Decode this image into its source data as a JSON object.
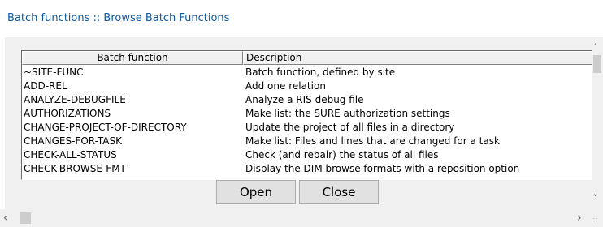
{
  "window": {
    "title": "Batch functions :: Browse Batch Functions"
  },
  "list": {
    "columns": [
      "Batch function",
      "Description"
    ],
    "rows": [
      {
        "name": "~SITE-FUNC",
        "description": "Batch function, defined by site"
      },
      {
        "name": "ADD-REL",
        "description": "Add one relation"
      },
      {
        "name": "ANALYZE-DEBUGFILE",
        "description": "Analyze a RIS debug file"
      },
      {
        "name": "AUTHORIZATIONS",
        "description": "Make list: the SURE authorization settings"
      },
      {
        "name": "CHANGE-PROJECT-OF-DIRECTORY",
        "description": "Update the project of all files in a directory"
      },
      {
        "name": "CHANGES-FOR-TASK",
        "description": "Make list: Files and lines that are changed for a task"
      },
      {
        "name": "CHECK-ALL-STATUS",
        "description": "Check (and repair) the status of all files"
      },
      {
        "name": "CHECK-BROWSE-FMT",
        "description": "Display the DIM browse formats with a reposition option"
      }
    ]
  },
  "buttons": {
    "open": "Open",
    "close": "Close"
  },
  "scrollbars": {
    "up_icon": "chevron-up-icon",
    "down_icon": "chevron-down-icon",
    "left_icon": "chevron-left-icon",
    "right_icon": "chevron-right-icon"
  },
  "colors": {
    "title_text": "#0d5aa6",
    "dialog_background": "#f0f0f0",
    "button_face": "#e1e1e1"
  }
}
